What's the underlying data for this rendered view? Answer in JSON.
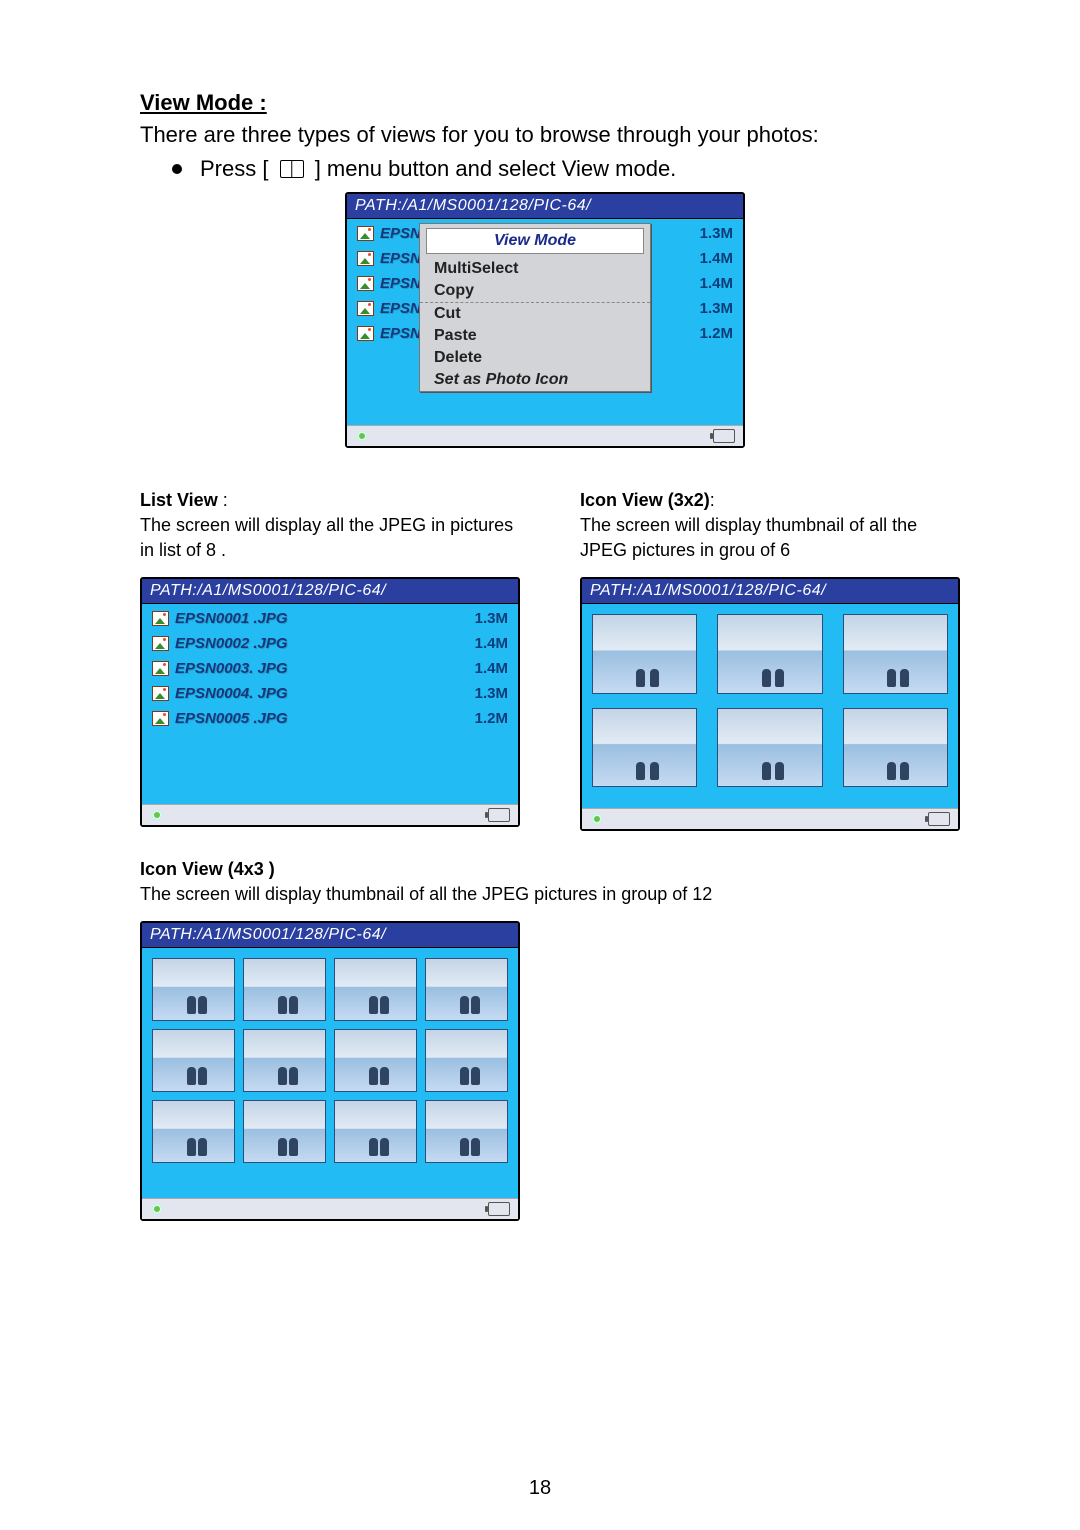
{
  "heading": "View Mode :",
  "intro": "There are three types of views for you to browse through your photos:",
  "bullet_press_before": "Press [ ",
  "bullet_press_after": " ] menu button and select View mode.",
  "path": "PATH:/A1/MS0001/128/PIC-64/",
  "popup": {
    "selected": "View  Mode",
    "items": [
      "MultiSelect",
      "Copy",
      "Cut",
      "Paste",
      "Delete",
      "Set as Photo Icon"
    ]
  },
  "short_files": [
    {
      "name": "EPSN",
      "size": "1.3M"
    },
    {
      "name": "EPSN",
      "size": "1.4M"
    },
    {
      "name": "EPSN",
      "size": "1.4M"
    },
    {
      "name": "EPSN",
      "size": "1.3M"
    },
    {
      "name": "EPSN",
      "size": "1.2M"
    }
  ],
  "list_view": {
    "title": "List View",
    "colon": " :",
    "desc": "The screen will display all the JPEG in pictures in list of 8 .",
    "files": [
      {
        "name": "EPSN0001 .JPG",
        "size": "1.3M"
      },
      {
        "name": "EPSN0002 .JPG",
        "size": "1.4M"
      },
      {
        "name": "EPSN0003. JPG",
        "size": "1.4M"
      },
      {
        "name": "EPSN0004. JPG",
        "size": "1.3M"
      },
      {
        "name": "EPSN0005 .JPG",
        "size": "1.2M"
      }
    ]
  },
  "icon3x2": {
    "title": "Icon View (3x2)",
    "colon": ":",
    "desc": "The screen will display thumbnail of all the JPEG pictures in grou of 6"
  },
  "icon4x3": {
    "title": "Icon View (4x3 )",
    "desc": "The screen will display thumbnail of all the JPEG pictures in group of 12"
  },
  "page": "18"
}
